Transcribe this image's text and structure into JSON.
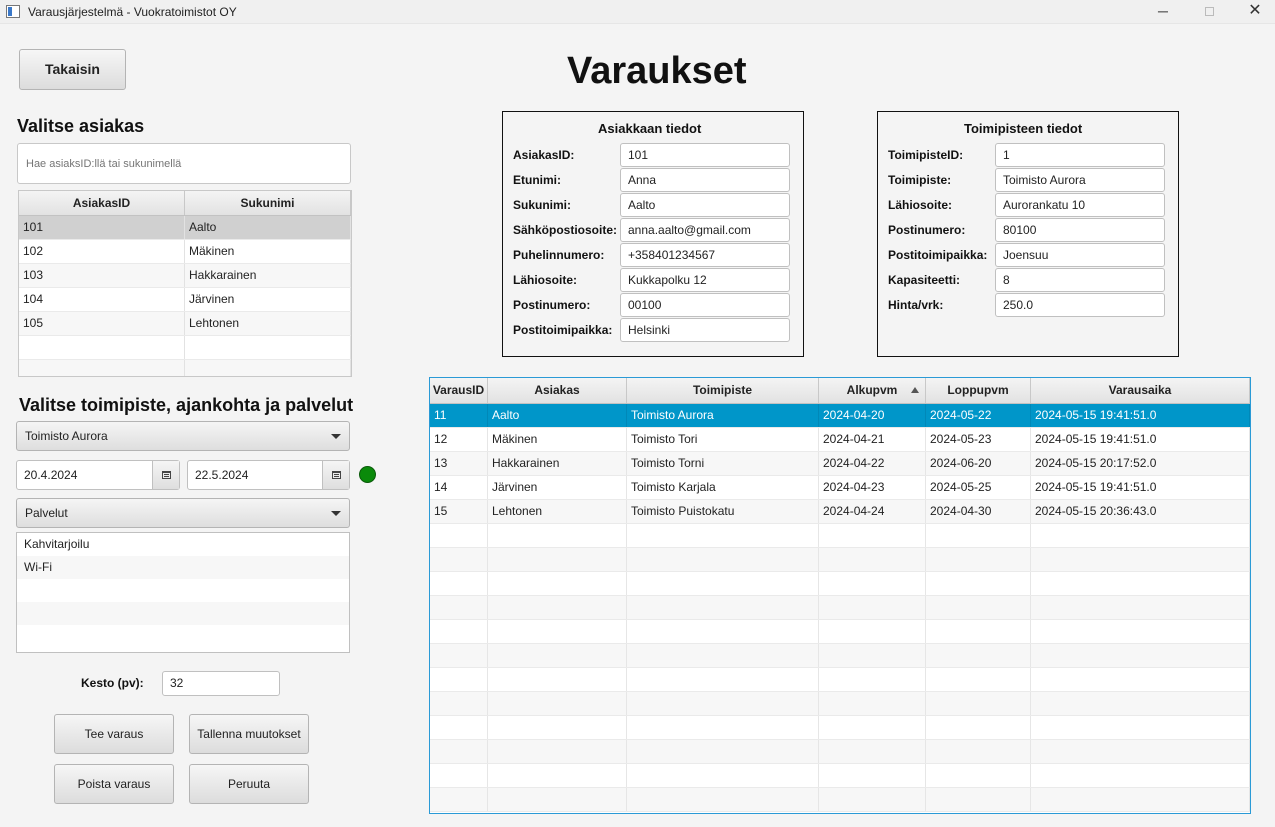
{
  "window": {
    "title": "Varausjärjestelmä - Vuokratoimistot OY",
    "minimize": "─",
    "close": "✕"
  },
  "back_button": "Takaisin",
  "page_title": "Varaukset",
  "customer_section": {
    "title": "Valitse asiakas",
    "search_placeholder": "Hae asiaksID:llä tai sukunimellä",
    "columns": [
      "AsiakasID",
      "Sukunimi"
    ],
    "rows": [
      [
        "101",
        "Aalto"
      ],
      [
        "102",
        "Mäkinen"
      ],
      [
        "103",
        "Hakkarainen"
      ],
      [
        "104",
        "Järvinen"
      ],
      [
        "105",
        "Lehtonen"
      ]
    ]
  },
  "booking_section": {
    "title": "Valitse toimipiste, ajankohta ja palvelut",
    "office_selected": "Toimisto Aurora",
    "start_date": "20.4.2024",
    "end_date": "22.5.2024",
    "status_color": "#0a8a0a",
    "services_selected": "Palvelut",
    "services_list": [
      "Kahvitarjoilu",
      "Wi-Fi"
    ],
    "duration_label": "Kesto (pv):",
    "duration_value": "32"
  },
  "actions": {
    "make": "Tee varaus",
    "save": "Tallenna muutokset",
    "delete": "Poista varaus",
    "cancel": "Peruuta"
  },
  "customer_info": {
    "title": "Asiakkaan tiedot",
    "fields": [
      {
        "label": "AsiakasID:",
        "value": "101"
      },
      {
        "label": "Etunimi:",
        "value": "Anna"
      },
      {
        "label": "Sukunimi:",
        "value": "Aalto"
      },
      {
        "label": "Sähköpostiosoite:",
        "value": "anna.aalto@gmail.com"
      },
      {
        "label": "Puhelinnumero:",
        "value": "+358401234567"
      },
      {
        "label": "Lähiosoite:",
        "value": "Kukkapolku 12"
      },
      {
        "label": "Postinumero:",
        "value": "00100"
      },
      {
        "label": "Postitoimipaikka:",
        "value": "Helsinki"
      }
    ]
  },
  "office_info": {
    "title": "Toimipisteen tiedot",
    "fields": [
      {
        "label": "ToimipisteID:",
        "value": "1"
      },
      {
        "label": "Toimipiste:",
        "value": "Toimisto Aurora"
      },
      {
        "label": "Lähiosoite:",
        "value": "Aurorankatu 10"
      },
      {
        "label": "Postinumero:",
        "value": "80100"
      },
      {
        "label": "Postitoimipaikka:",
        "value": "Joensuu"
      },
      {
        "label": "Kapasiteetti:",
        "value": "8"
      },
      {
        "label": "Hinta/vrk:",
        "value": "250.0"
      }
    ]
  },
  "reservations": {
    "columns": [
      "VarausID",
      "Asiakas",
      "Toimipiste",
      "Alkupvm",
      "Loppupvm",
      "Varausaika"
    ],
    "sorted_column": "Alkupvm",
    "rows": [
      [
        "11",
        "Aalto",
        "Toimisto Aurora",
        "2024-04-20",
        "2024-05-22",
        "2024-05-15 19:41:51.0"
      ],
      [
        "12",
        "Mäkinen",
        "Toimisto Tori",
        "2024-04-21",
        "2024-05-23",
        "2024-05-15 19:41:51.0"
      ],
      [
        "13",
        "Hakkarainen",
        "Toimisto Torni",
        "2024-04-22",
        "2024-06-20",
        "2024-05-15 20:17:52.0"
      ],
      [
        "14",
        "Järvinen",
        "Toimisto Karjala",
        "2024-04-23",
        "2024-05-25",
        "2024-05-15 19:41:51.0"
      ],
      [
        "15",
        "Lehtonen",
        "Toimisto Puistokatu",
        "2024-04-24",
        "2024-04-30",
        "2024-05-15 20:36:43.0"
      ]
    ]
  }
}
